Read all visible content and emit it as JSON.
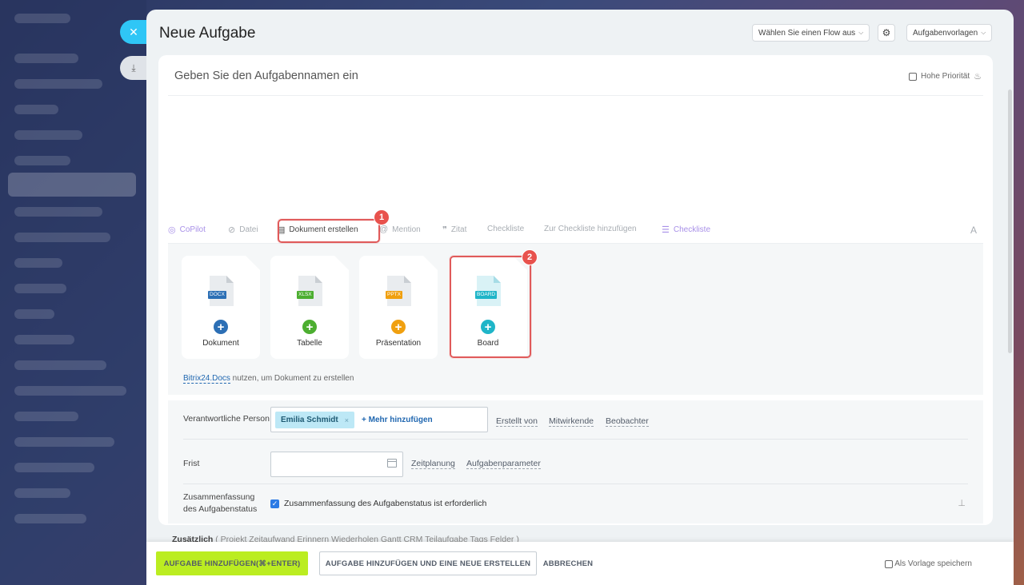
{
  "header": {
    "title": "Neue Aufgabe",
    "flow_select": "Wählen Sie einen Flow aus",
    "templates": "Aufgabenvorlagen"
  },
  "task": {
    "title_placeholder": "Geben Sie den Aufgabennamen ein",
    "high_priority": "Hohe Priorität"
  },
  "toolbar": {
    "copilot": "CoPilot",
    "file": "Datei",
    "create_doc": "Dokument erstellen",
    "mention": "Mention",
    "quote": "Zitat",
    "checklist": "Checkliste",
    "add_to_checklist": "Zur Checkliste hinzufügen",
    "checklist2": "Checkliste",
    "font": "A"
  },
  "annotations": {
    "badge1": "1",
    "badge2": "2"
  },
  "doc_types": [
    {
      "label": "Dokument",
      "tag": "DOCX",
      "color": "#2c6fb5"
    },
    {
      "label": "Tabelle",
      "tag": "XLSX",
      "color": "#4cae30"
    },
    {
      "label": "Präsentation",
      "tag": "PPTX",
      "color": "#f0a010"
    },
    {
      "label": "Board",
      "tag": "BOARD",
      "color": "#1fb5c8"
    }
  ],
  "docs_note": {
    "link": "Bitrix24.Docs",
    "text": " nutzen, um Dokument zu erstellen"
  },
  "fields": {
    "responsible_label": "Verantwortliche Person",
    "responsible_chip": "Emilia Schmidt",
    "chip_remove": "×",
    "add_more": "+ Mehr hinzufügen",
    "created_by": "Erstellt von",
    "participants": "Mitwirkende",
    "observers": "Beobachter",
    "deadline_label": "Frist",
    "scheduling": "Zeitplanung",
    "task_params": "Aufgabenparameter",
    "summary_label": "Zusammenfassung des Aufgabenstatus",
    "summary_check": "Zusammenfassung des Aufgabenstatus ist erforderlich"
  },
  "extra": {
    "label": "Zusätzlich",
    "items": "( Projekt   Zeitaufwand   Erinnern   Wiederholen   Gantt   CRM   Teilaufgabe   Tags   Felder )"
  },
  "footer": {
    "add_task": "AUFGABE HINZUFÜGEN(⌘+ENTER)",
    "add_and_new": "AUFGABE HINZUFÜGEN UND EINE NEUE ERSTELLEN",
    "cancel": "ABBRECHEN",
    "save_template": "Als Vorlage speichern"
  },
  "colors": {
    "accent_green": "#bbed21",
    "highlight_red": "#e05a5a",
    "link_blue": "#2067b0"
  }
}
